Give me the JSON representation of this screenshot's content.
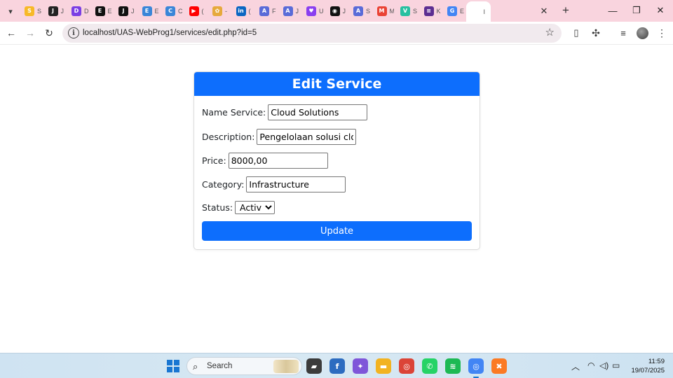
{
  "browser": {
    "tabs": [
      {
        "icon": "S",
        "color": "#f7b928",
        "title": "S"
      },
      {
        "icon": "J",
        "color": "#222222",
        "title": "J"
      },
      {
        "icon": "D",
        "color": "#7b3fe4",
        "title": "D"
      },
      {
        "icon": "E",
        "color": "#111111",
        "title": "E"
      },
      {
        "icon": "J",
        "color": "#111111",
        "title": "J"
      },
      {
        "icon": "E",
        "color": "#3a86d8",
        "title": "E"
      },
      {
        "icon": "C",
        "color": "#3a86d8",
        "title": "C"
      },
      {
        "icon": "▶",
        "color": "#ff0000",
        "title": "("
      },
      {
        "icon": "✿",
        "color": "#e6a93c",
        "title": "-"
      },
      {
        "icon": "in",
        "color": "#0a66c2",
        "title": "("
      },
      {
        "icon": "A",
        "color": "#5a6bd8",
        "title": "F"
      },
      {
        "icon": "A",
        "color": "#5a6bd8",
        "title": "J"
      },
      {
        "icon": "♥",
        "color": "#8a3ff0",
        "title": "U"
      },
      {
        "icon": "◉",
        "color": "#111111",
        "title": "J"
      },
      {
        "icon": "A",
        "color": "#5a6bd8",
        "title": "S"
      },
      {
        "icon": "M",
        "color": "#ea4335",
        "title": "M"
      },
      {
        "icon": "V",
        "color": "#27c0a0",
        "title": "S"
      },
      {
        "icon": "≡",
        "color": "#5c2d91",
        "title": "K"
      },
      {
        "icon": "G",
        "color": "#4285f4",
        "title": "E"
      },
      {
        "icon": "",
        "color": "#ffffff",
        "title": "I"
      }
    ],
    "close_tab": "✕",
    "new_tab": "+",
    "minimize": "—",
    "restore": "❐",
    "close_window": "✕",
    "back": "←",
    "forward": "→",
    "reload": "↻",
    "url": "localhost/UAS-WebProg1/services/edit.php?id=5"
  },
  "page": {
    "heading": "Edit Service",
    "fields": {
      "name": {
        "label": "Name Service:",
        "value": "Cloud Solutions"
      },
      "description": {
        "label": "Description:",
        "value": "Pengelolaan solusi cloud u"
      },
      "price": {
        "label": "Price:",
        "value": "8000,00"
      },
      "category": {
        "label": "Category:",
        "value": "Infrastructure"
      },
      "status": {
        "label": "Status:",
        "value": "Active",
        "options": [
          "Active"
        ]
      }
    },
    "submit_label": "Update",
    "accent_color": "#0d6efd"
  },
  "taskbar": {
    "search_label": "Search",
    "apps": [
      {
        "name": "file-explorer-dark",
        "glyph": "▰",
        "color": "#3b3b3b"
      },
      {
        "name": "facebook",
        "glyph": "f",
        "color": "#2d6cc0"
      },
      {
        "name": "copilot",
        "glyph": "✦",
        "color": "#7f56d9"
      },
      {
        "name": "file-explorer",
        "glyph": "▬",
        "color": "#f2b321"
      },
      {
        "name": "chrome",
        "glyph": "◎",
        "color": "#db4437"
      },
      {
        "name": "whatsapp",
        "glyph": "✆",
        "color": "#25d366"
      },
      {
        "name": "spotify",
        "glyph": "≋",
        "color": "#1db954"
      },
      {
        "name": "chrome-profile",
        "glyph": "◎",
        "color": "#4285f4"
      },
      {
        "name": "xampp",
        "glyph": "✖",
        "color": "#fb7a24"
      }
    ],
    "time": "11:59",
    "date": "19/07/2025"
  }
}
